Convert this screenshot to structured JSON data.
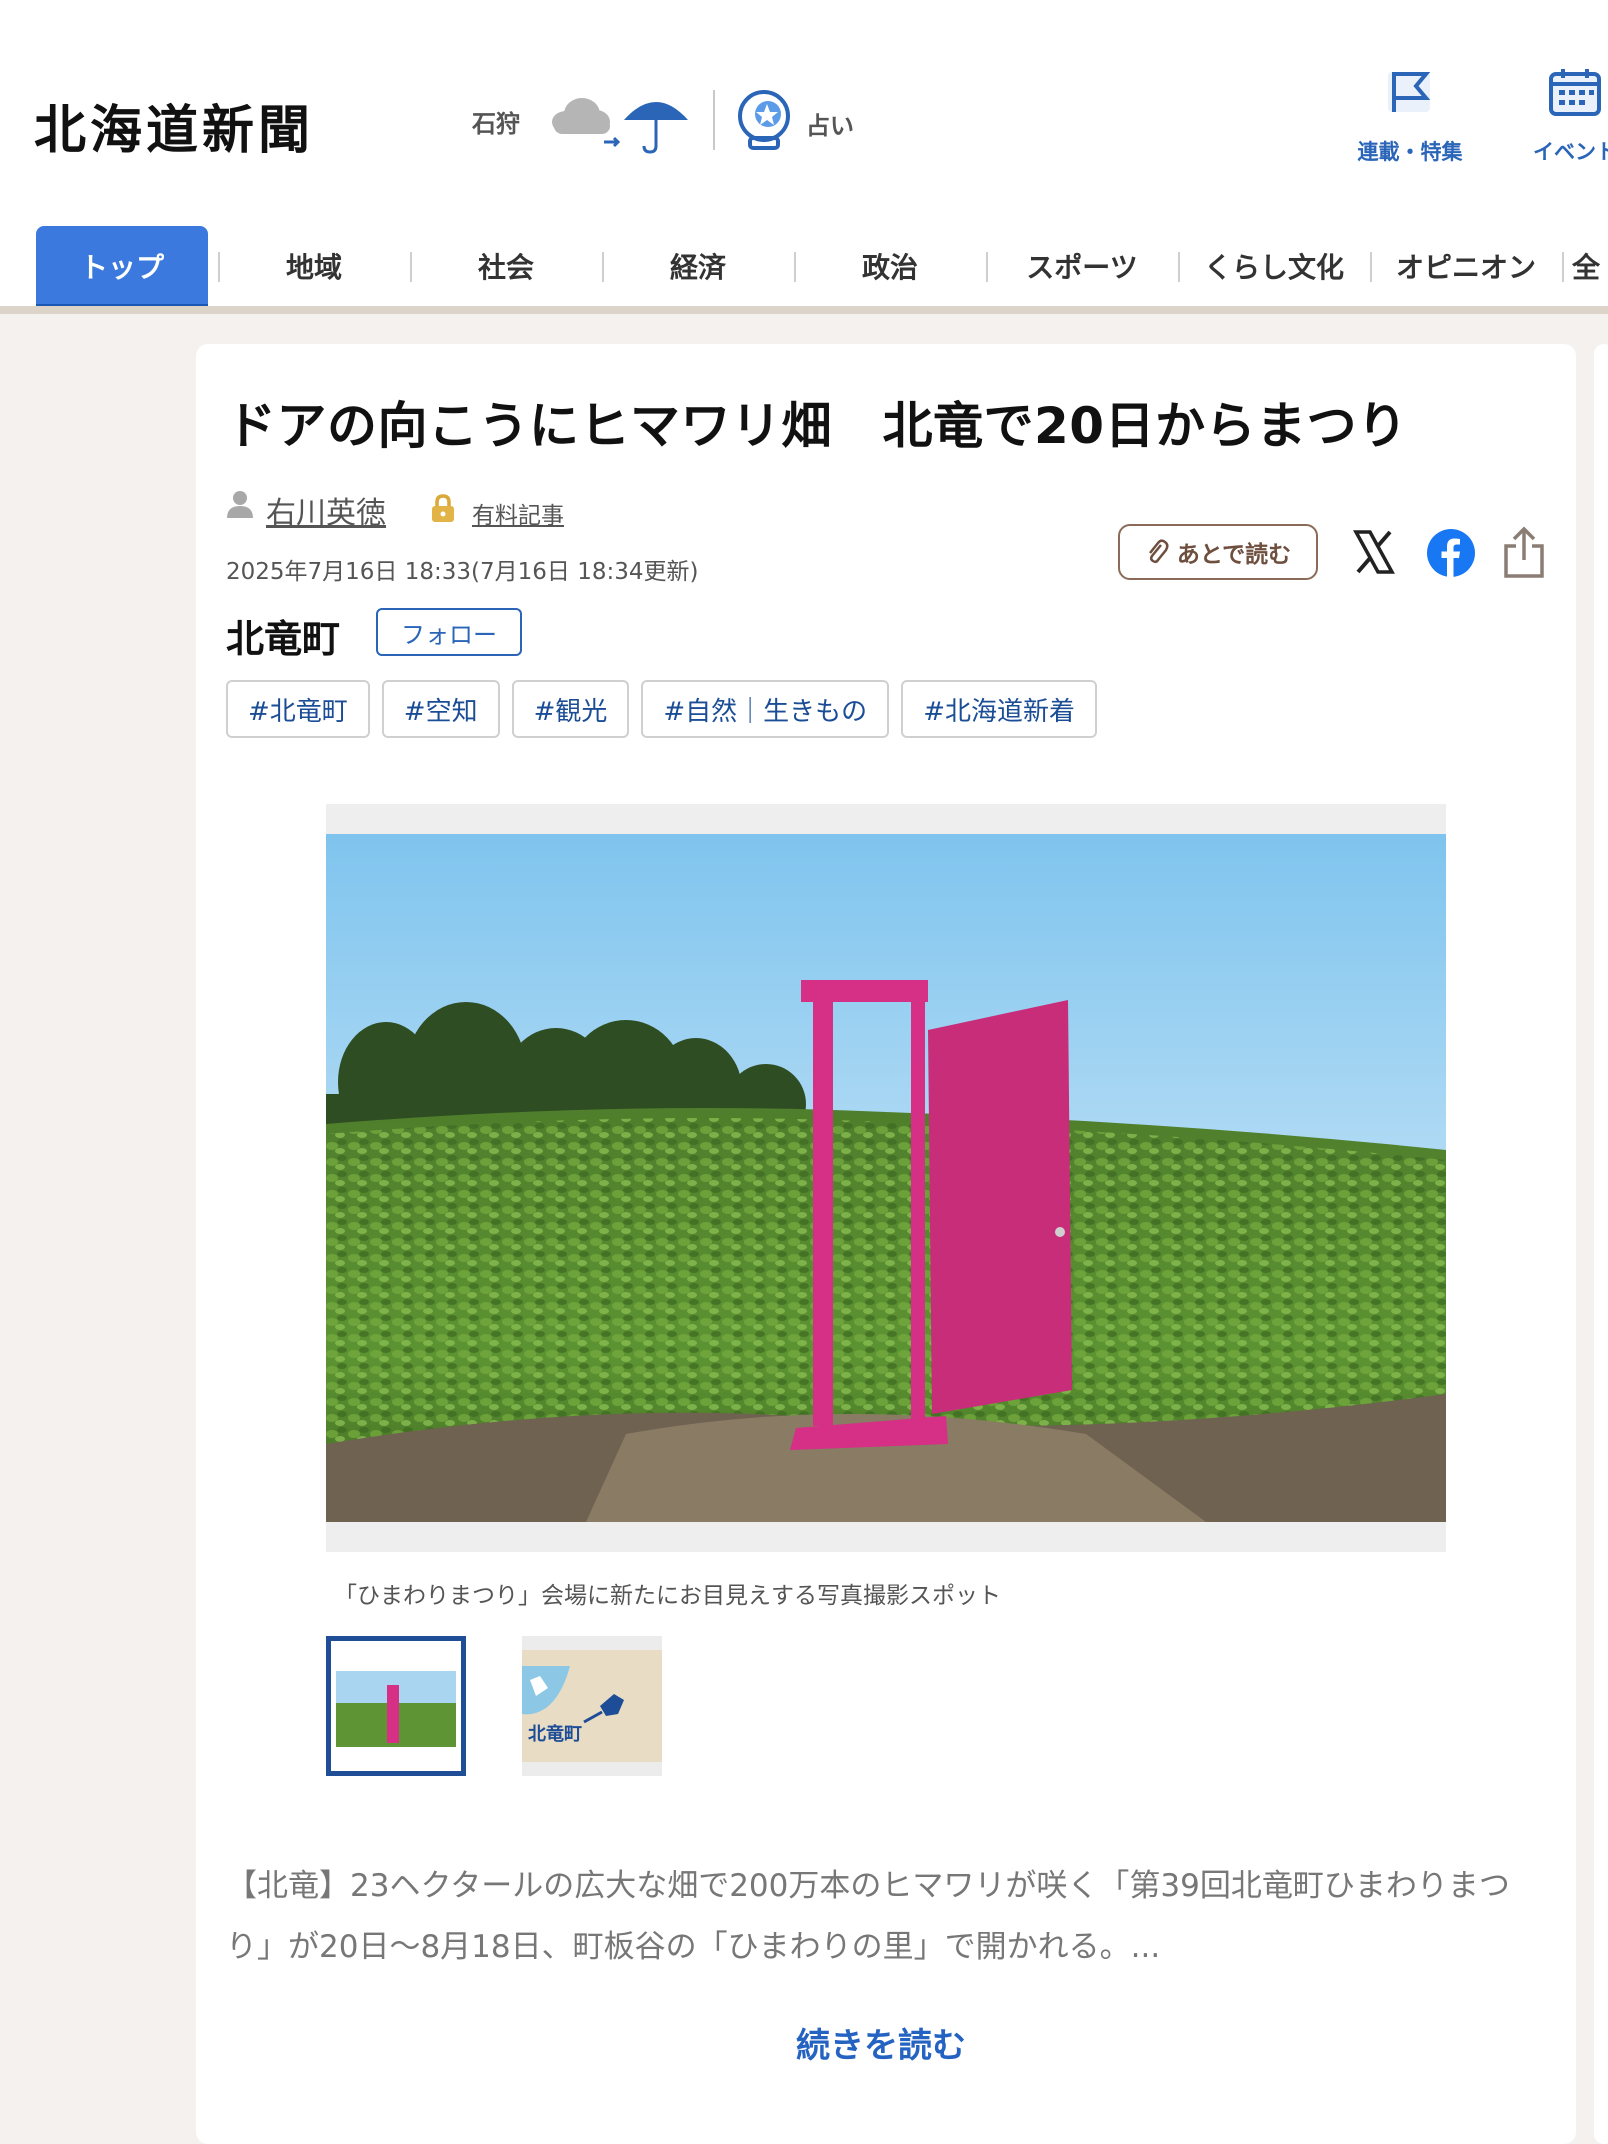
{
  "header": {
    "logo": "北海道新聞",
    "region": "石狩",
    "weather_icon": "cloud-umbrella-icon",
    "fortune_label": "占い",
    "links": [
      {
        "label": "連載・特集",
        "icon": "flag-icon"
      },
      {
        "label": "イベント",
        "icon": "calendar-icon"
      }
    ]
  },
  "nav": {
    "items": [
      "トップ",
      "地域",
      "社会",
      "経済",
      "政治",
      "スポーツ",
      "くらし文化",
      "オピニオン",
      "全"
    ],
    "active_index": 0,
    "accent": "#3b79de"
  },
  "article": {
    "headline": "ドアの向こうにヒマワリ畑　北竜で20日からまつり",
    "author": "右川英徳",
    "paid_label": "有料記事",
    "date": "2025年7月16日 18:33(7月16日 18:34更新)",
    "read_later": "あとで読む",
    "area": "北竜町",
    "follow": "フォロー",
    "tags": [
      "#北竜町",
      "#空知",
      "#観光",
      "#自然｜生きもの",
      "#北海道新着"
    ],
    "caption": "「ひまわりまつり」会場に新たにお目見えする写真撮影スポット",
    "thumb_map_label": "北竜町",
    "lead": "【北竜】23ヘクタールの広大な畑で200万本のヒマワリが咲く「第39回北竜町ひまわりまつり」が20日〜8月18日、町板谷の「ひまわりの里」で開かれる。...",
    "more": "続きを読む"
  }
}
